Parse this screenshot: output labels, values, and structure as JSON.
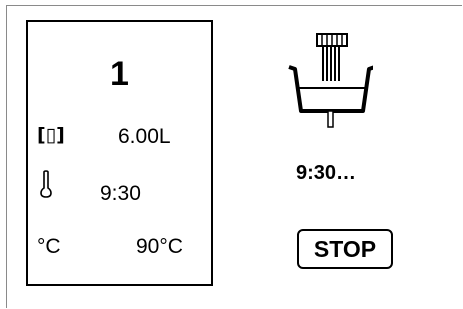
{
  "status": {
    "step_number": "1",
    "volume_icon": "[▯]",
    "volume_value": "6.00L",
    "time_value": "9:30",
    "temperature_unit": "°C",
    "temperature_value": "90°C"
  },
  "process": {
    "appliance_icon": "brewing-vessel-icon",
    "countdown": "9:30…"
  },
  "controls": {
    "stop_label": "STOP"
  },
  "colors": {
    "foreground": "#000000",
    "background": "#ffffff",
    "frame_line": "#8a8a8a"
  }
}
